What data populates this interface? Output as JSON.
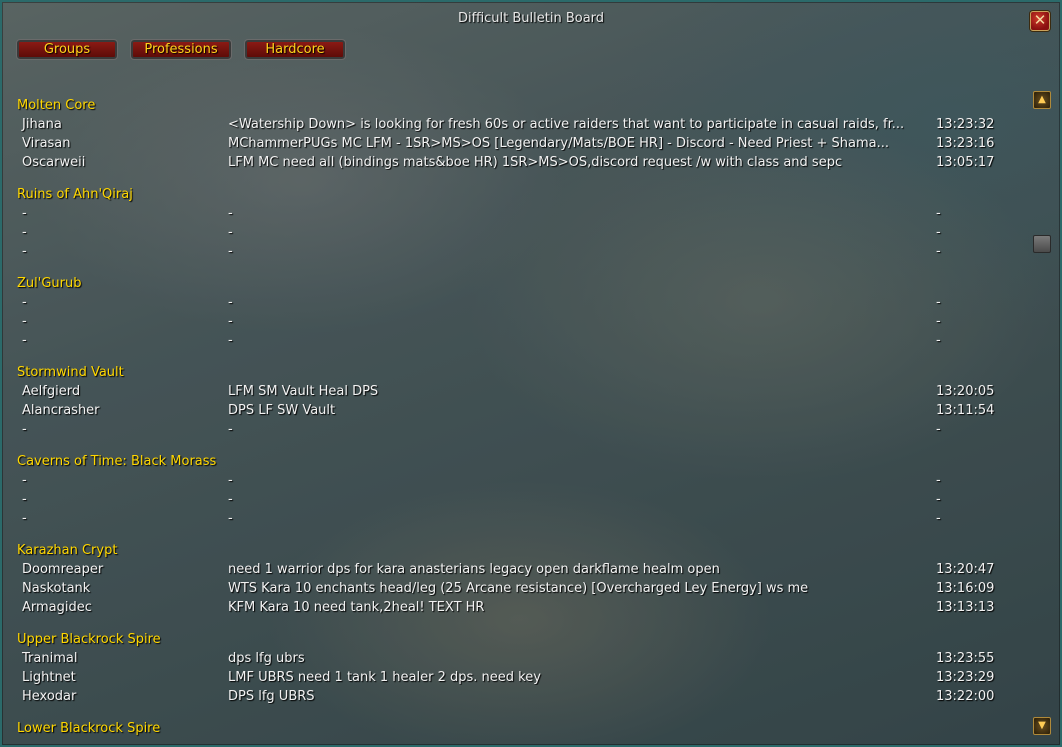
{
  "window": {
    "title": "Difficult Bulletin Board",
    "close_glyph": "✕"
  },
  "tabs": [
    {
      "label": "Groups"
    },
    {
      "label": "Professions"
    },
    {
      "label": "Hardcore"
    }
  ],
  "sections": [
    {
      "name": "Molten Core",
      "rows": [
        {
          "name": "Jihana",
          "message": "<Watership Down> is looking for fresh 60s or active raiders that want to participate in casual raids, fr...",
          "time": "13:23:32"
        },
        {
          "name": "Virasan",
          "message": "MChammerPUGs MC LFM - 1SR>MS>OS [Legendary/Mats/BOE HR] - Discord - Need Priest + Shama...",
          "time": "13:23:16"
        },
        {
          "name": "Oscarweii",
          "message": "LFM MC need all (bindings mats&boe HR) 1SR>MS>OS,discord request /w with class and sepc",
          "time": "13:05:17"
        }
      ]
    },
    {
      "name": "Ruins of Ahn'Qiraj",
      "rows": [
        {
          "name": "-",
          "message": "-",
          "time": "-"
        },
        {
          "name": "-",
          "message": "-",
          "time": "-"
        },
        {
          "name": "-",
          "message": "-",
          "time": "-"
        }
      ]
    },
    {
      "name": "Zul'Gurub",
      "rows": [
        {
          "name": "-",
          "message": "-",
          "time": "-"
        },
        {
          "name": "-",
          "message": "-",
          "time": "-"
        },
        {
          "name": "-",
          "message": "-",
          "time": "-"
        }
      ]
    },
    {
      "name": "Stormwind Vault",
      "rows": [
        {
          "name": "Aelfgierd",
          "message": "LFM SM Vault Heal DPS",
          "time": "13:20:05"
        },
        {
          "name": "Alancrasher",
          "message": "DPS LF SW Vault",
          "time": "13:11:54"
        },
        {
          "name": "-",
          "message": "-",
          "time": "-"
        }
      ]
    },
    {
      "name": "Caverns of Time: Black Morass",
      "rows": [
        {
          "name": "-",
          "message": "-",
          "time": "-"
        },
        {
          "name": "-",
          "message": "-",
          "time": "-"
        },
        {
          "name": "-",
          "message": "-",
          "time": "-"
        }
      ]
    },
    {
      "name": "Karazhan Crypt",
      "rows": [
        {
          "name": "Doomreaper",
          "message": "need 1 warrior dps for kara anasterians legacy open darkflame healm open",
          "time": "13:20:47"
        },
        {
          "name": "Naskotank",
          "message": "WTS Kara 10 enchants head/leg (25 Arcane resistance) [Overcharged Ley Energy] ws me",
          "time": "13:16:09"
        },
        {
          "name": "Armagidec",
          "message": "KFM Kara 10 need tank,2heal! TEXT HR",
          "time": "13:13:13"
        }
      ]
    },
    {
      "name": "Upper Blackrock Spire",
      "rows": [
        {
          "name": "Tranimal",
          "message": "dps lfg ubrs",
          "time": "13:23:55"
        },
        {
          "name": "Lightnet",
          "message": "LMF UBRS need 1 tank 1 healer 2 dps. need key",
          "time": "13:23:29"
        },
        {
          "name": "Hexodar",
          "message": "DPS lfg UBRS",
          "time": "13:22:00"
        }
      ]
    },
    {
      "name": "Lower Blackrock Spire",
      "rows": []
    }
  ],
  "scrollbar": {
    "up_icon": "scroll-up-arrow",
    "down_icon": "scroll-down-arrow",
    "up_glyph": "▲",
    "down_glyph": "▼"
  }
}
